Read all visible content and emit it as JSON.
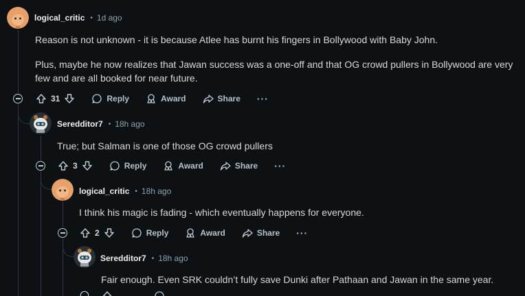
{
  "comments": [
    {
      "author": "logical_critic",
      "time": "1d ago",
      "paragraphs": [
        "Reason is not unknown - it is because Atlee has burnt his fingers in Bollywood with Baby John.",
        "Plus, maybe he now realizes that Jawan success was a one-off and that OG crowd pullers in Bollywood are very",
        "few and are all booked for near future."
      ],
      "votes": "31",
      "avatar": "orange-snoo-avatar"
    },
    {
      "author": "Seredditor7",
      "time": "18h ago",
      "paragraphs": [
        "True; but Salman is one of those OG crowd pullers"
      ],
      "votes": "3",
      "avatar": "robot-snoo-avatar"
    },
    {
      "author": "logical_critic",
      "time": "18h ago",
      "paragraphs": [
        "I think his magic is fading - which eventually happens for everyone."
      ],
      "votes": "2",
      "avatar": "orange-snoo-avatar"
    },
    {
      "author": "Seredditor7",
      "time": "18h ago",
      "paragraphs": [
        "Fair enough. Even SRK couldn’t fully save Dunki after Pathaan and Jawan in the same year."
      ],
      "votes": "",
      "avatar": "robot-snoo-avatar"
    }
  ],
  "actions": {
    "reply": "Reply",
    "award": "Award",
    "share": "Share",
    "more": "···"
  },
  "separator": "•",
  "colors": {
    "background": "#0e1113",
    "text": "#d7dadc",
    "meta": "#8ba2ad",
    "thread_line": "#33383c",
    "orange_avatar": "#e8a06a"
  }
}
